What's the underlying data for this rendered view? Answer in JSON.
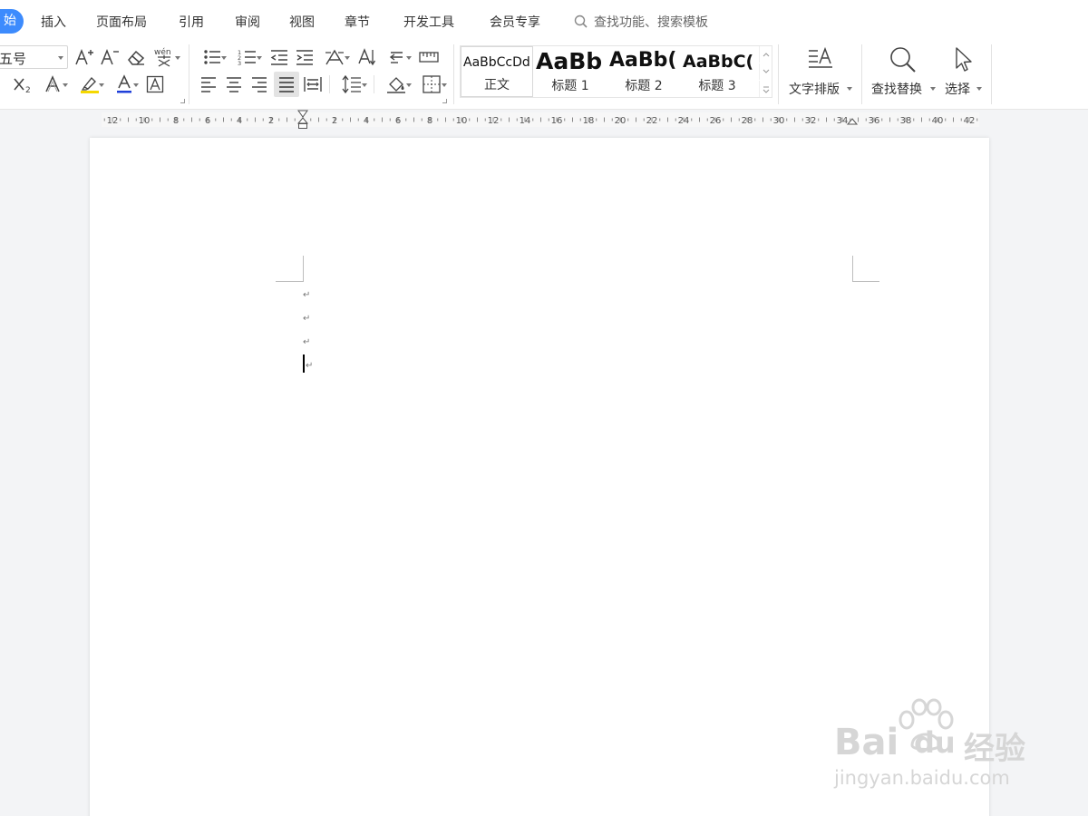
{
  "menu": {
    "active_tab": "始",
    "tabs": [
      "插入",
      "页面布局",
      "引用",
      "审阅",
      "视图",
      "章节",
      "开发工具",
      "会员专享"
    ],
    "search_placeholder": "查找功能、搜索模板"
  },
  "font": {
    "size_value": "五号",
    "pinyin_label": "wén"
  },
  "styles": {
    "items": [
      {
        "sample": "AaBbCcDd",
        "label": "正文",
        "selected": true
      },
      {
        "sample": "AaBb",
        "label": "标题 1",
        "selected": false
      },
      {
        "sample": "AaBb(",
        "label": "标题 2",
        "selected": false
      },
      {
        "sample": "AaBbC(",
        "label": "标题 3",
        "selected": false
      }
    ]
  },
  "actions": {
    "text_layout": "文字排版",
    "find_replace": "查找替换",
    "select": "选择"
  },
  "ruler": {
    "left_labels": [
      "12",
      "10",
      "8",
      "6",
      "4",
      "2"
    ],
    "right_labels": [
      "2",
      "4",
      "6",
      "8",
      "10",
      "12",
      "14",
      "16",
      "18",
      "20",
      "22",
      "24",
      "26",
      "28",
      "30",
      "32",
      "34",
      "36",
      "38",
      "40",
      "42"
    ]
  },
  "document": {
    "paragraph_mark": "↵"
  },
  "watermark": {
    "brand_latin_1": "Bai",
    "brand_latin_2": "du",
    "brand_cn": "经验",
    "url": "jingyan.baidu.com"
  },
  "colors": {
    "accent": "#3d8bfd",
    "highlight": "#f5d800",
    "font_color_bar": "#1f3fd9"
  }
}
